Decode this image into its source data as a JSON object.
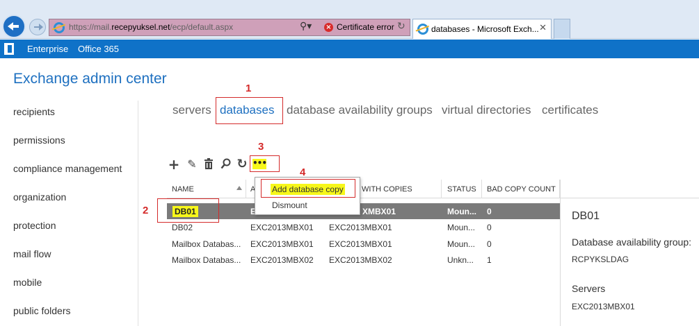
{
  "browser": {
    "url_prefix": "https://mail.",
    "url_domain": "recepyuksel.net",
    "url_path": "/ecp/default.aspx",
    "cert_error": "Certificate error",
    "tab_title": "databases - Microsoft Exch...",
    "icons": {
      "back": "back-arrow-icon",
      "forward": "forward-arrow-icon",
      "search": "search-icon",
      "refresh": "refresh-icon",
      "close": "close-icon"
    }
  },
  "topbar": {
    "color": "#0f72c8",
    "links": [
      "Enterprise",
      "Office 365"
    ]
  },
  "page": {
    "title": "Exchange admin center",
    "accent": "#1e70c0"
  },
  "leftnav": {
    "items": [
      "recipients",
      "permissions",
      "compliance management",
      "organization",
      "protection",
      "mail flow",
      "mobile",
      "public folders"
    ]
  },
  "subtabs": {
    "items": [
      "servers",
      "databases",
      "database availability groups",
      "virtual directories",
      "certificates"
    ],
    "active": "databases"
  },
  "toolbar": {
    "tools": [
      "add-icon",
      "edit-icon",
      "delete-icon",
      "search-icon",
      "refresh-icon"
    ],
    "more_label": "•••"
  },
  "grid": {
    "headers": [
      "NAME",
      "A",
      "WITH COPIES",
      "STATUS",
      "BAD COPY COUNT"
    ],
    "rows": [
      {
        "name": "DB01",
        "active": "E",
        "copies": "XMBX01",
        "status": "Moun...",
        "bad": "0"
      },
      {
        "name": "DB02",
        "active": "EXC2013MBX01",
        "copies": "EXC2013MBX01",
        "status": "Moun...",
        "bad": "0"
      },
      {
        "name": "Mailbox Databas...",
        "active": "EXC2013MBX01",
        "copies": "EXC2013MBX01",
        "status": "Moun...",
        "bad": "0"
      },
      {
        "name": "Mailbox Databas...",
        "active": "EXC2013MBX02",
        "copies": "EXC2013MBX02",
        "status": "Unkn...",
        "bad": "1"
      }
    ],
    "selected_row_color": "#7a7a7a"
  },
  "context_menu": {
    "items": [
      "Add database copy",
      "Dismount"
    ]
  },
  "details": {
    "title": "DB01",
    "dag_label": "Database availability group:",
    "dag_value": "RCPYKSLDAG",
    "servers_label": "Servers",
    "servers_value": "EXC2013MBX01"
  },
  "annotations": {
    "numbers": [
      "1",
      "2",
      "3",
      "4"
    ],
    "color": "#d42a2a",
    "highlight": "#f7f71a"
  }
}
